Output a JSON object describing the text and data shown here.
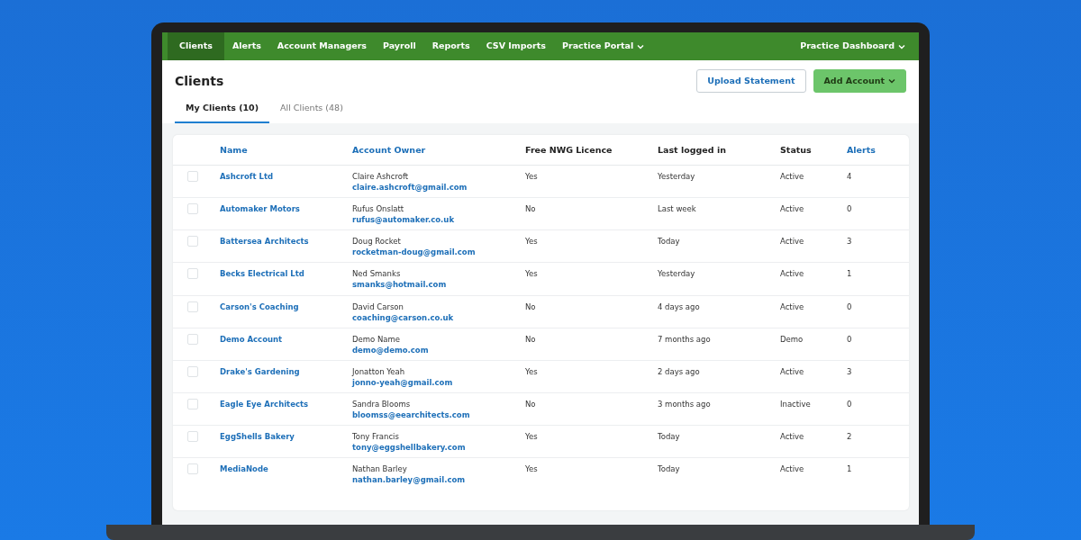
{
  "nav": {
    "items": [
      {
        "label": "Clients",
        "selected": true,
        "dropdown": false
      },
      {
        "label": "Alerts",
        "selected": false,
        "dropdown": false
      },
      {
        "label": "Account Managers",
        "selected": false,
        "dropdown": false
      },
      {
        "label": "Payroll",
        "selected": false,
        "dropdown": false
      },
      {
        "label": "Reports",
        "selected": false,
        "dropdown": false
      },
      {
        "label": "CSV Imports",
        "selected": false,
        "dropdown": false
      },
      {
        "label": "Practice Portal",
        "selected": false,
        "dropdown": true
      }
    ],
    "right": {
      "label": "Practice Dashboard",
      "dropdown": true
    }
  },
  "page": {
    "title": "Clients",
    "buttons": [
      {
        "label": "Upload Statement",
        "kind": "outline",
        "dropdown": false
      },
      {
        "label": "Add Account",
        "kind": "primary",
        "dropdown": true
      }
    ]
  },
  "tabs": [
    {
      "label": "My Clients (10)",
      "selected": true
    },
    {
      "label": "All Clients (48)",
      "selected": false
    }
  ],
  "table": {
    "columns": [
      {
        "label": "Name",
        "link": true
      },
      {
        "label": "Account Owner",
        "link": true
      },
      {
        "label": "Free NWG Licence",
        "link": false
      },
      {
        "label": "Last logged in",
        "link": false
      },
      {
        "label": "Status",
        "link": false
      },
      {
        "label": "Alerts",
        "link": true
      }
    ],
    "rows": [
      {
        "checked": false,
        "name": "Ashcroft Ltd",
        "owner": "Claire Ashcroft",
        "email": "claire.ashcroft@gmail.com",
        "licence": "Yes",
        "last_login": "Yesterday",
        "status": "Active",
        "alerts": "4"
      },
      {
        "checked": false,
        "name": "Automaker Motors",
        "owner": "Rufus Onslatt",
        "email": "rufus@automaker.co.uk",
        "licence": "No",
        "last_login": "Last week",
        "status": "Active",
        "alerts": "0"
      },
      {
        "checked": false,
        "name": "Battersea Architects",
        "owner": "Doug Rocket",
        "email": "rocketman-doug@gmail.com",
        "licence": "Yes",
        "last_login": "Today",
        "status": "Active",
        "alerts": "3"
      },
      {
        "checked": false,
        "name": "Becks Electrical Ltd",
        "owner": "Ned Smanks",
        "email": "smanks@hotmail.com",
        "licence": "Yes",
        "last_login": "Yesterday",
        "status": "Active",
        "alerts": "1"
      },
      {
        "checked": false,
        "name": "Carson's Coaching",
        "owner": "David Carson",
        "email": "coaching@carson.co.uk",
        "licence": "No",
        "last_login": "4 days ago",
        "status": "Active",
        "alerts": "0"
      },
      {
        "checked": false,
        "name": "Demo Account",
        "owner": "Demo Name",
        "email": "demo@demo.com",
        "licence": "No",
        "last_login": "7 months ago",
        "status": "Demo",
        "alerts": "0"
      },
      {
        "checked": false,
        "name": "Drake's Gardening",
        "owner": "Jonatton Yeah",
        "email": "jonno-yeah@gmail.com",
        "licence": "Yes",
        "last_login": "2 days ago",
        "status": "Active",
        "alerts": "3"
      },
      {
        "checked": false,
        "name": "Eagle Eye Architects",
        "owner": "Sandra Blooms",
        "email": "bloomss@eearchitects.com",
        "licence": "No",
        "last_login": "3 months ago",
        "status": "Inactive",
        "alerts": "0"
      },
      {
        "checked": false,
        "name": "EggShells Bakery",
        "owner": "Tony Francis",
        "email": "tony@eggshellbakery.com",
        "licence": "Yes",
        "last_login": "Today",
        "status": "Active",
        "alerts": "2"
      },
      {
        "checked": false,
        "name": "MediaNode",
        "owner": "Nathan Barley",
        "email": "nathan.barley@gmail.com",
        "licence": "Yes",
        "last_login": "Today",
        "status": "Active",
        "alerts": "1"
      }
    ]
  }
}
